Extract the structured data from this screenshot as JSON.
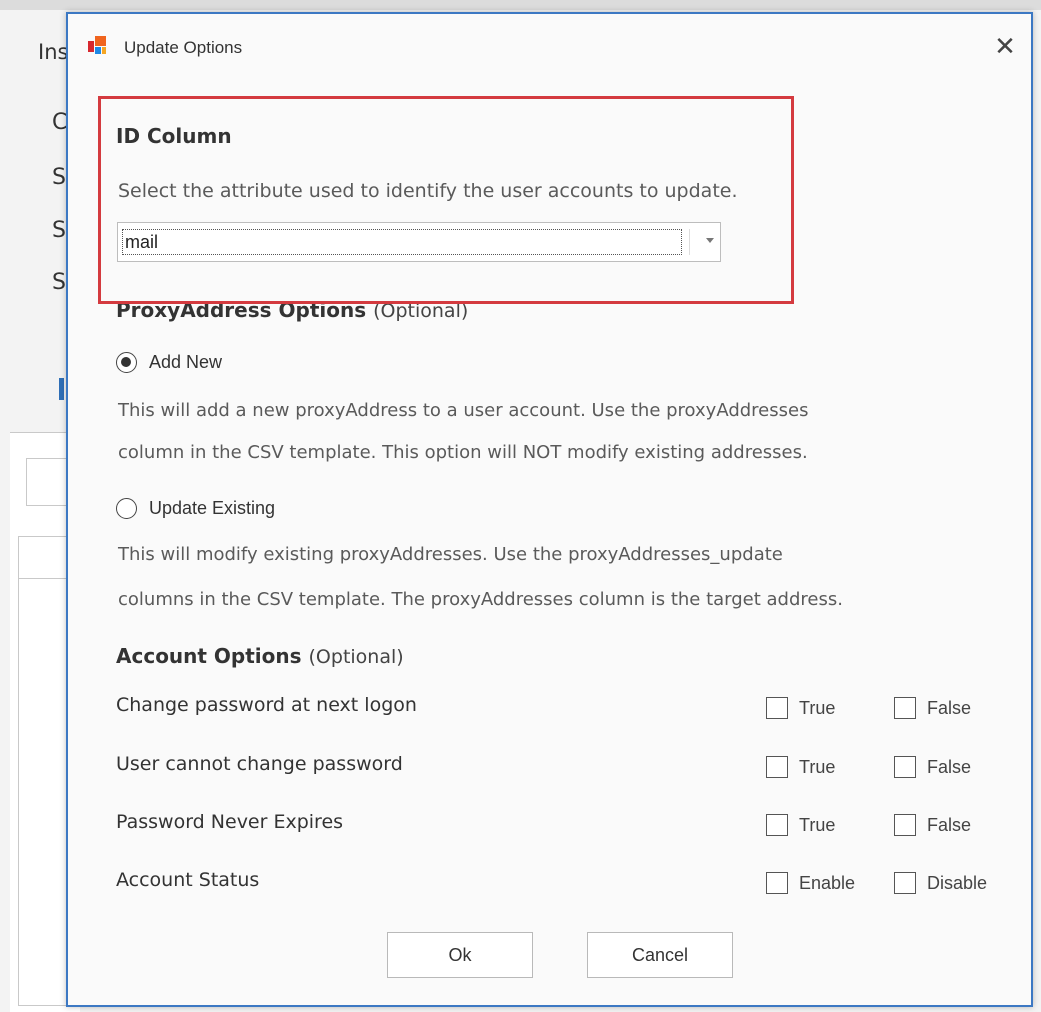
{
  "background": {
    "title": "Ins",
    "letters": [
      "C",
      "S",
      "S",
      "S"
    ]
  },
  "dialog": {
    "title": "Update Options",
    "close_glyph": "✕",
    "id_column": {
      "title": "ID Column",
      "description": "Select the attribute used to identify the user accounts to update.",
      "selected_value": "mail"
    },
    "proxy": {
      "title": "ProxyAddress Options",
      "optional": "(Optional)",
      "add_new": {
        "label": "Add New",
        "checked": true,
        "desc_line1": "This will add a new proxyAddress to a user account. Use the proxyAddresses",
        "desc_line2": "column in the CSV template. This option will NOT modify existing addresses."
      },
      "update_existing": {
        "label": "Update Existing",
        "checked": false,
        "desc_line1": "This will modify existing proxyAddresses. Use the proxyAddresses_update",
        "desc_line2": "columns in the CSV template. The proxyAddresses column is the target address."
      }
    },
    "account": {
      "title": "Account Options",
      "optional": "(Optional)",
      "rows": [
        {
          "label": "Change password at next logon",
          "opt1": "True",
          "opt2": "False"
        },
        {
          "label": "User cannot change password",
          "opt1": "True",
          "opt2": "False"
        },
        {
          "label": "Password Never Expires",
          "opt1": "True",
          "opt2": "False"
        },
        {
          "label": "Account Status",
          "opt1": "Enable",
          "opt2": "Disable"
        }
      ]
    },
    "buttons": {
      "ok": "Ok",
      "cancel": "Cancel"
    }
  },
  "colors": {
    "highlight": "#d43a3f",
    "window_border": "#3c78c3",
    "icon_orange": "#f0641e",
    "icon_red": "#d7282f",
    "icon_blue": "#1e88e5",
    "icon_yellow": "#f5a623"
  }
}
